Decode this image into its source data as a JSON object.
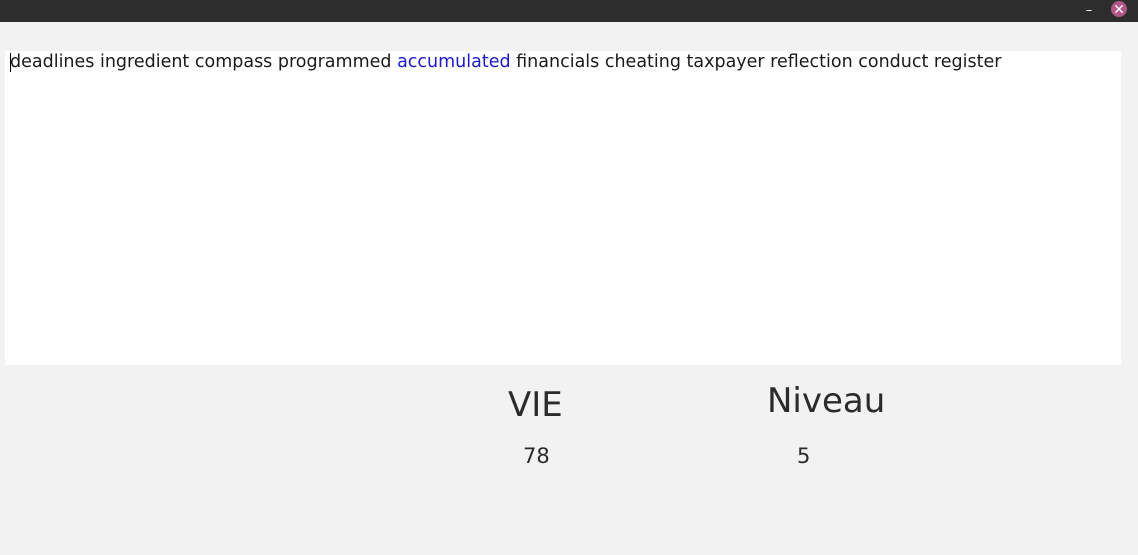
{
  "window": {
    "minimize_label": "–",
    "close_icon": "close-icon",
    "close_color": "#b0578a"
  },
  "typing": {
    "words_before": "deadlines ingredient compass programmed ",
    "current_word": "accumulated",
    "words_after": " financials cheating taxpayer reflection conduct register",
    "current_word_color": "#1a1acc"
  },
  "stats": {
    "life_label": "VIE",
    "life_value": "78",
    "level_label": "Niveau",
    "level_value": "5"
  }
}
